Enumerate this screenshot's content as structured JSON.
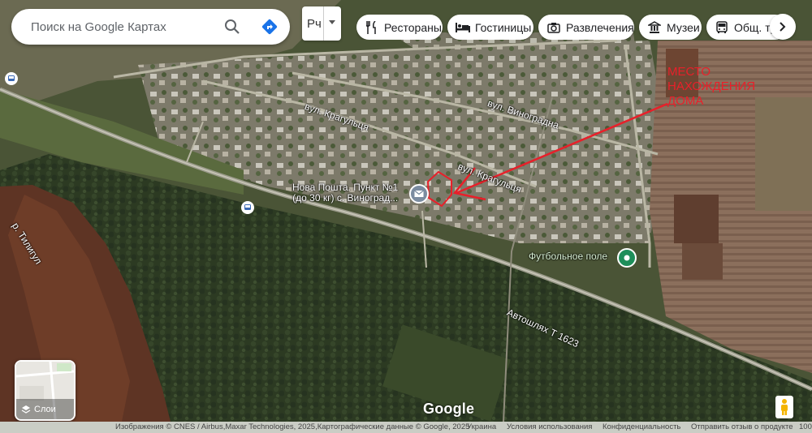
{
  "search": {
    "placeholder": "Поиск на Google Картах"
  },
  "language": {
    "value": "Рч"
  },
  "chips": [
    {
      "label": "Рестораны",
      "icon": "fork-knife-icon"
    },
    {
      "label": "Гостиницы",
      "icon": "bed-icon"
    },
    {
      "label": "Развлечения",
      "icon": "camera-icon"
    },
    {
      "label": "Музеи",
      "icon": "museum-icon"
    },
    {
      "label": "Общ. тра",
      "icon": "bus-icon"
    }
  ],
  "map": {
    "streets": [
      "вул. Крагульця",
      "вул. Виноградна",
      "вул. Крагульця",
      "Автошлях Т 1623"
    ],
    "river": "р. Тилигул",
    "poi_post": {
      "line1": "Нова Пошта. Пункт №1",
      "line2": "(до 30 кг) с. Виноград..."
    },
    "poi_stadium": "Футбольное поле",
    "annotation": {
      "line1": "МЕСТО",
      "line2": "НАХОЖДЕНИЯ",
      "line3": "ДОМА",
      "color": "#e8202a"
    }
  },
  "layers": {
    "label": "Слои"
  },
  "google_logo": "Google",
  "footer": {
    "attribution": "Изображения © CNES / Airbus,Maxar Technologies, 2025,Картографические данные © Google, 2025",
    "country": "Украина",
    "terms": "Условия использования",
    "privacy": "Конфиденциальность",
    "feedback": "Отправить отзыв о продукте",
    "scale": "100"
  }
}
